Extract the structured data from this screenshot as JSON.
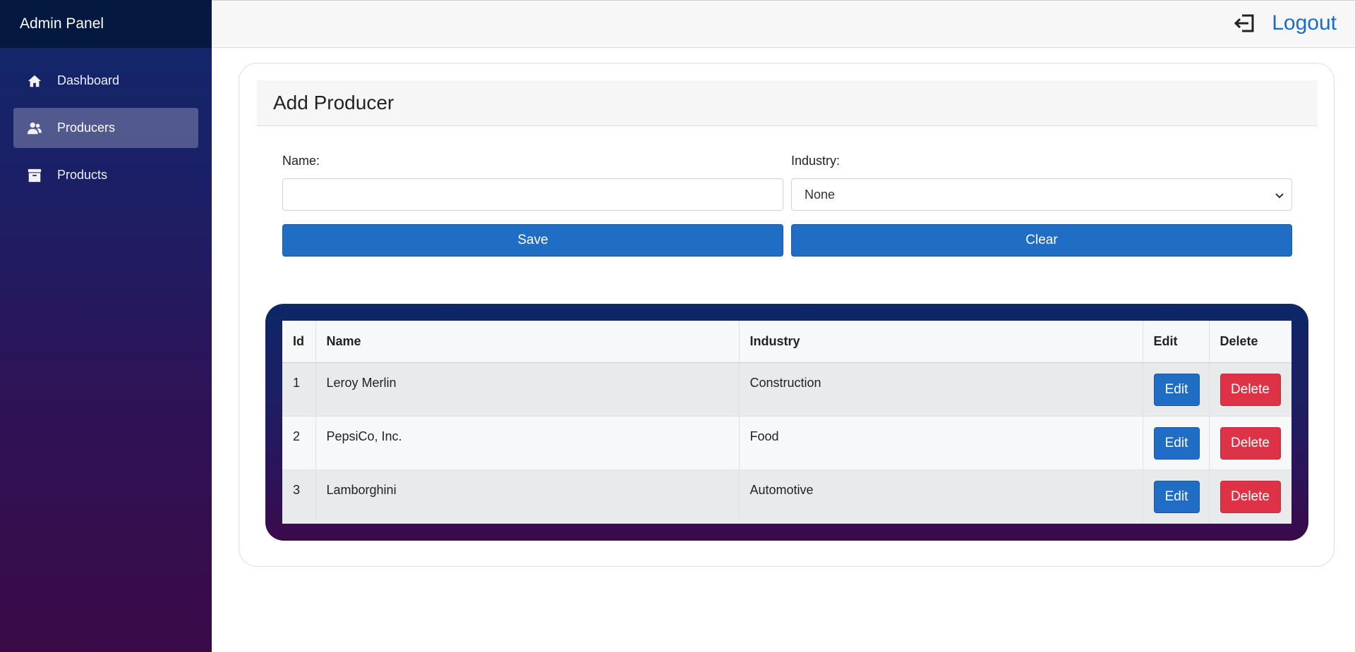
{
  "sidebar": {
    "brand": "Admin Panel",
    "items": [
      {
        "label": "Dashboard",
        "icon": "home-icon",
        "active": false
      },
      {
        "label": "Producers",
        "icon": "users-icon",
        "active": true
      },
      {
        "label": "Products",
        "icon": "box-icon",
        "active": false
      }
    ]
  },
  "topbar": {
    "logout_label": "Logout",
    "logout_icon": "logout-icon"
  },
  "form": {
    "title": "Add Producer",
    "name_label": "Name:",
    "name_value": "",
    "industry_label": "Industry:",
    "industry_selected": "None",
    "save_label": "Save",
    "clear_label": "Clear"
  },
  "table": {
    "headers": [
      "Id",
      "Name",
      "Industry",
      "Edit",
      "Delete"
    ],
    "rows": [
      {
        "id": "1",
        "name": "Leroy Merlin",
        "industry": "Construction",
        "edit": "Edit",
        "delete": "Delete"
      },
      {
        "id": "2",
        "name": "PepsiCo, Inc.",
        "industry": "Food",
        "edit": "Edit",
        "delete": "Delete"
      },
      {
        "id": "3",
        "name": "Lamborghini",
        "industry": "Automotive",
        "edit": "Edit",
        "delete": "Delete"
      }
    ]
  },
  "colors": {
    "primary": "#1f6dc4",
    "danger": "#de3347",
    "sidebar_top": "#10286a",
    "sidebar_bottom": "#3a0a48"
  }
}
